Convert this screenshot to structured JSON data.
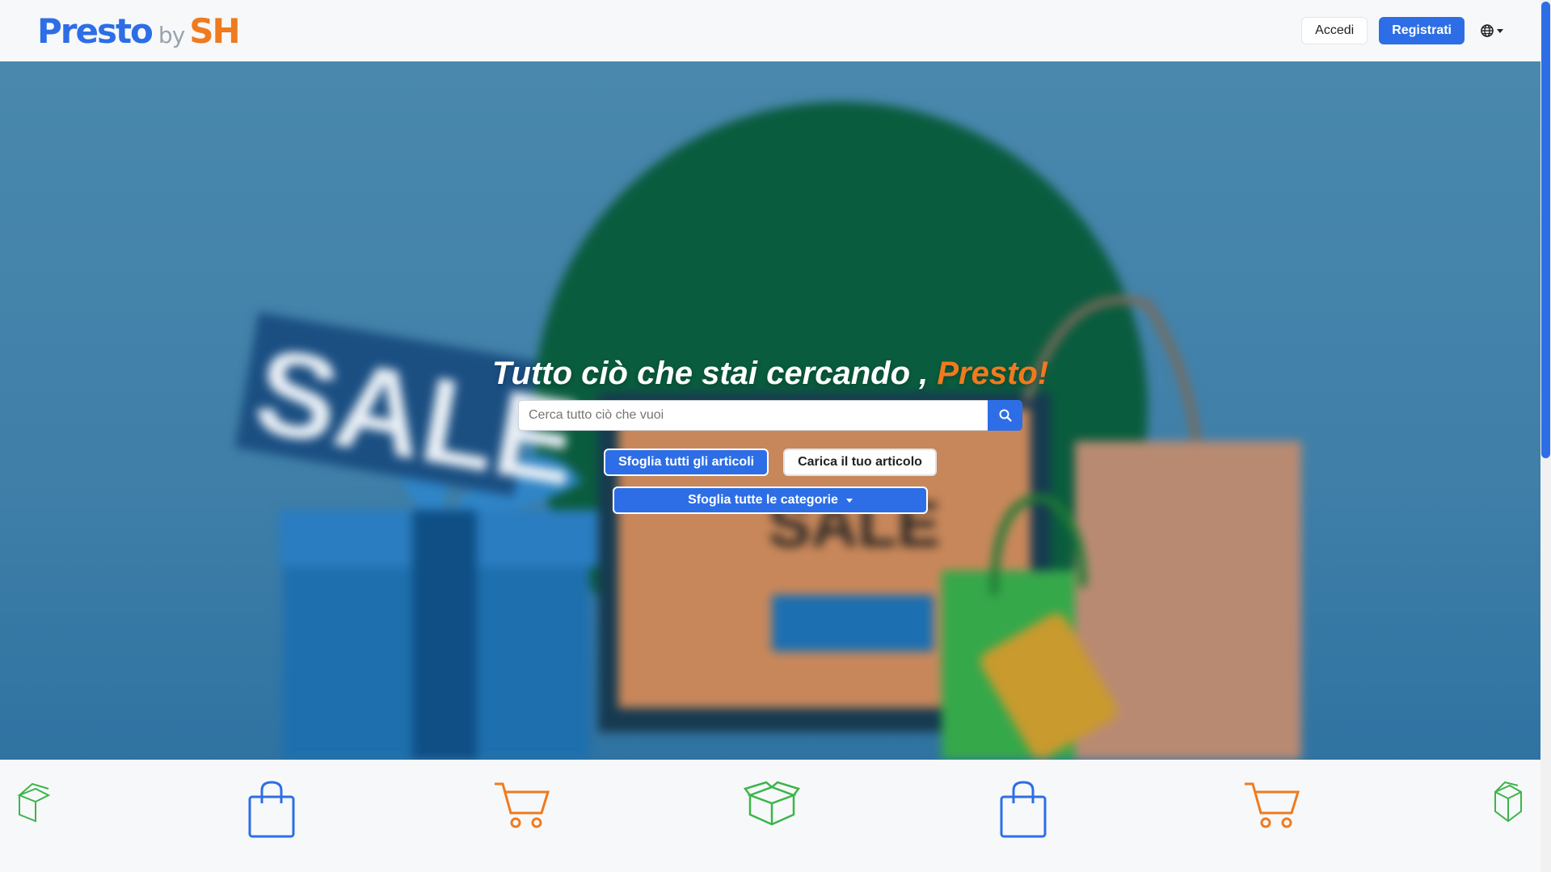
{
  "brand": {
    "name": "Presto",
    "by": "by",
    "suffix": "SH"
  },
  "nav": {
    "login": "Accedi",
    "register": "Registrati",
    "language_icon": "globe-icon"
  },
  "hero": {
    "headline": "Tutto ciò che stai cercando ,",
    "headline_accent": "Presto!",
    "search_placeholder": "Cerca tutto ciò che vuoi",
    "browse_articles": "Sfoglia tutti gli articoli",
    "upload_article": "Carica il tuo articolo",
    "browse_categories": "Sfoglia tutte le categorie"
  },
  "icon_strip": [
    "box-icon",
    "shopping-bag-icon",
    "cart-icon",
    "box-icon",
    "shopping-bag-icon",
    "cart-icon",
    "box-icon"
  ],
  "colors": {
    "primary": "#2d6ee6",
    "accent": "#f07a1e",
    "green": "#3cb54a"
  }
}
